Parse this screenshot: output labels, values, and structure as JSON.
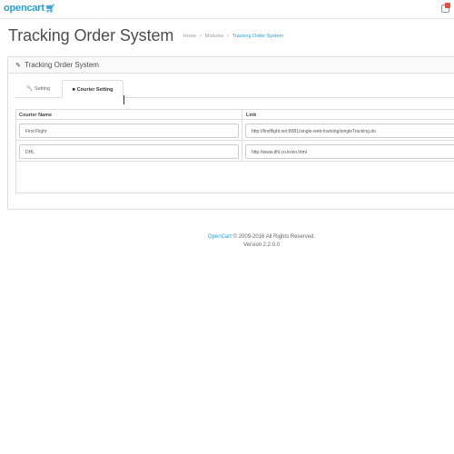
{
  "header": {
    "logo_text": "opencart",
    "logo_cart_icon": "cart-icon",
    "notification_icon": "bell-icon"
  },
  "page": {
    "title": "Tracking Order System",
    "breadcrumb": [
      "Home",
      "Modules",
      "Tracking Order System"
    ]
  },
  "panel": {
    "title": "Tracking Order System",
    "title_icon": "pencil-icon",
    "tabs": [
      {
        "label": "Setting",
        "icon": "wrench-icon",
        "active": false
      },
      {
        "label": "Courier Setting",
        "icon": "truck-icon",
        "active": true
      }
    ],
    "table": {
      "columns": [
        "Courier Name",
        "Link"
      ],
      "rows": [
        {
          "name": "First Flight",
          "link": "http://firstflight.net:8081/single-web-tracking/singleTracking.do"
        },
        {
          "name": "DHL",
          "link": "http://www.dhl.co.in/en.html"
        }
      ]
    }
  },
  "footer": {
    "brand": "OpenCart",
    "copyright": " © 2009-2016 All Rights Reserved.",
    "version": "Version 2.2.0.0"
  },
  "colors": {
    "accent": "#2b9fd8",
    "badge": "#e3503e"
  }
}
